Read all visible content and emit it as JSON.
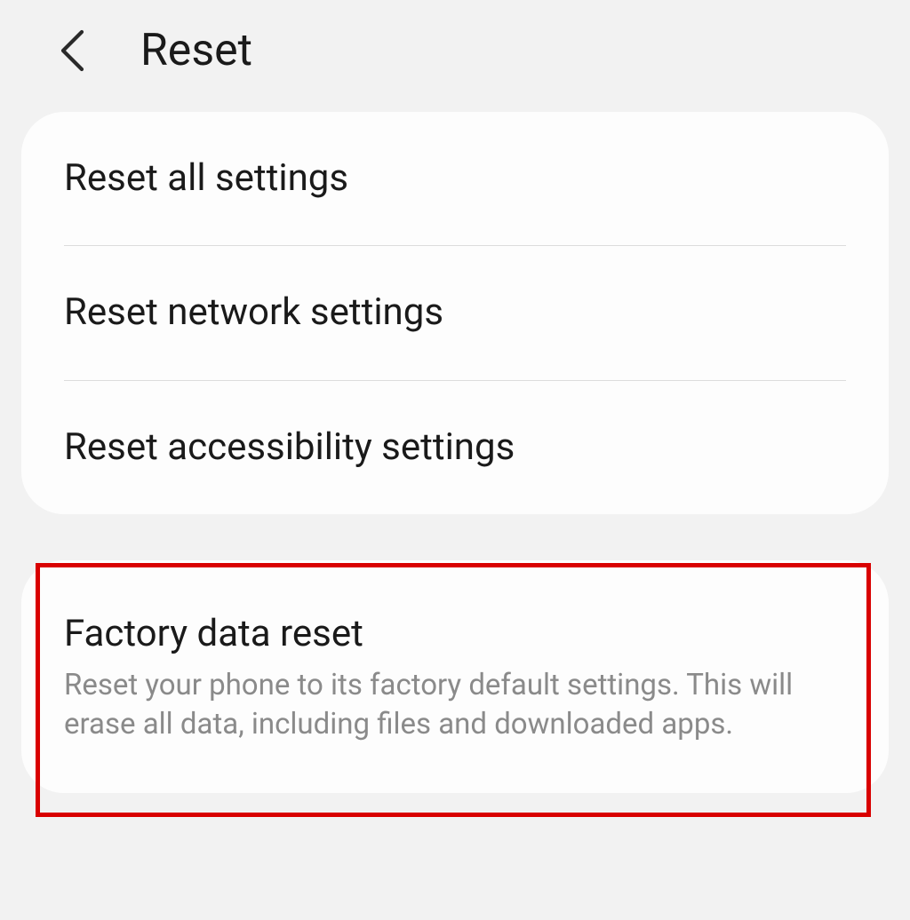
{
  "header": {
    "title": "Reset",
    "back_icon": "back-icon"
  },
  "group1": {
    "items": [
      {
        "title": "Reset all settings"
      },
      {
        "title": "Reset network settings"
      },
      {
        "title": "Reset accessibility settings"
      }
    ]
  },
  "group2": {
    "items": [
      {
        "title": "Factory data reset",
        "description": "Reset your phone to its factory default settings. This will erase all data, including files and downloaded apps."
      }
    ]
  },
  "highlight": {
    "color": "#d90000"
  }
}
